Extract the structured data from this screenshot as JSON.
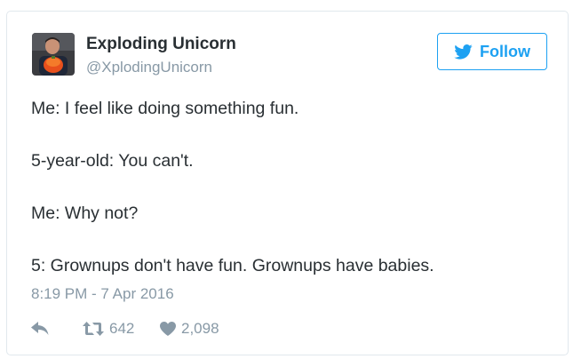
{
  "tweet": {
    "author": {
      "display_name": "Exploding Unicorn",
      "handle": "@XplodingUnicorn",
      "avatar": "avatar-photo"
    },
    "follow_button": {
      "label": "Follow",
      "icon": "twitter-bird-icon"
    },
    "lines": [
      "Me: I feel like doing something fun.",
      "5-year-old: You can't.",
      "Me: Why not?",
      "5: Grownups don't have fun. Grownups have babies."
    ],
    "timestamp": "8:19 PM - 7 Apr 2016",
    "actions": {
      "reply_icon": "reply-icon",
      "retweet_icon": "retweet-icon",
      "retweet_count": "642",
      "like_icon": "heart-icon",
      "like_count": "2,098"
    }
  },
  "colors": {
    "text": "#292f33",
    "secondary": "#8899a6",
    "accent": "#1da1f2",
    "border": "#e1e8ed"
  }
}
